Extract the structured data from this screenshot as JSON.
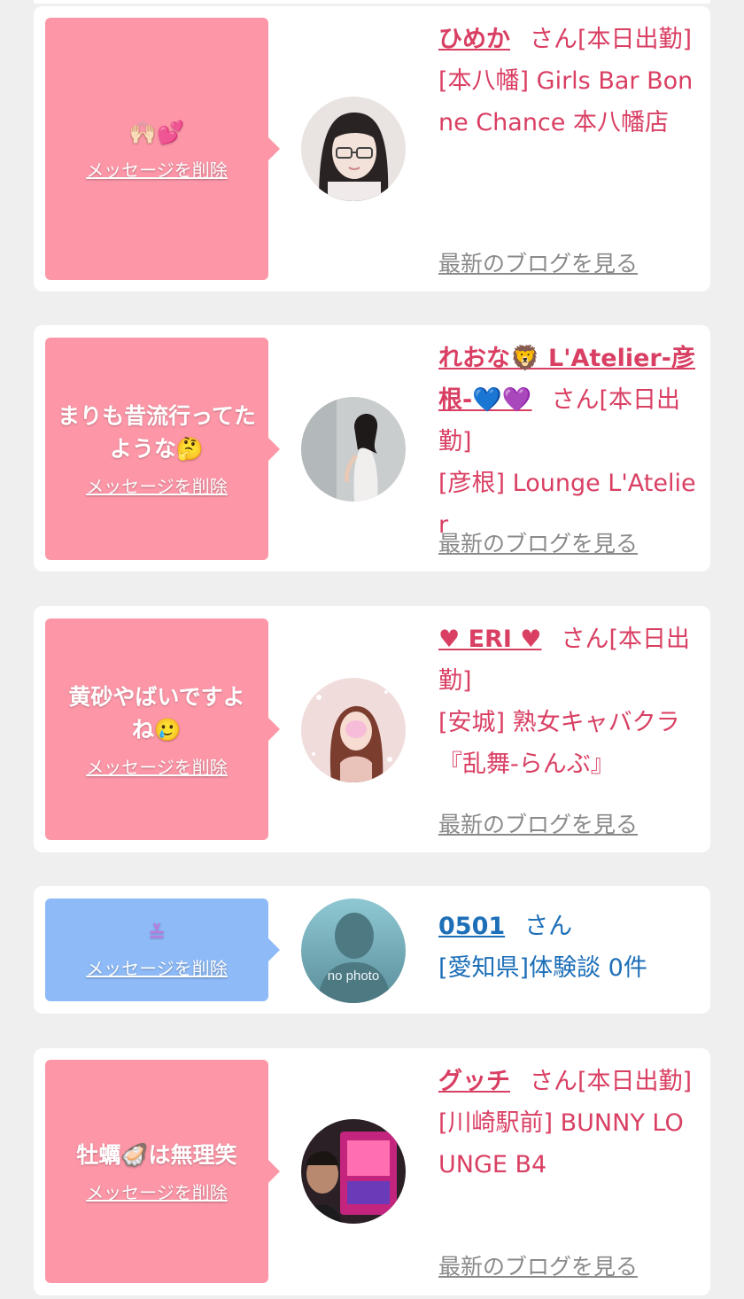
{
  "common": {
    "delete_label": "メッセージを削除",
    "blog_label": "最新のブログを見る"
  },
  "messages": [
    {
      "message": "🙌🏻💕",
      "name": "ひめか",
      "suffix": "さん[本日出勤]",
      "shop": "[本八幡] Girls Bar Bonne Chance 本八幡店",
      "bubble_color": "#fd97a8"
    },
    {
      "message": "まりも昔流行ってたような🤔",
      "name": "れおな🦁 L'Atelier-彦根-💙💜",
      "suffix": "さん[本日出勤]",
      "shop": "[彦根] Lounge L'Atelier",
      "bubble_color": "#fd97a8"
    },
    {
      "message": "黄砂やばいですよね🥲",
      "name": "♥ ERI ♥",
      "suffix": "さん[本日出勤]",
      "shop": "[安城] 熟女キャバクラ『乱舞-らんぶ』",
      "bubble_color": "#fd97a8"
    },
    {
      "message": "≚",
      "name": "0501",
      "suffix": "さん",
      "shop": "[愛知県]体験談 0件",
      "avatar_text": "no photo",
      "bubble_color": "#8ebbf8"
    },
    {
      "message": "牡蠣🦪は無理笑",
      "name": "グッチ",
      "suffix": "さん[本日出勤]",
      "shop": "[川崎駅前] BUNNY LOUNGE B4",
      "bubble_color": "#fd97a8"
    }
  ]
}
